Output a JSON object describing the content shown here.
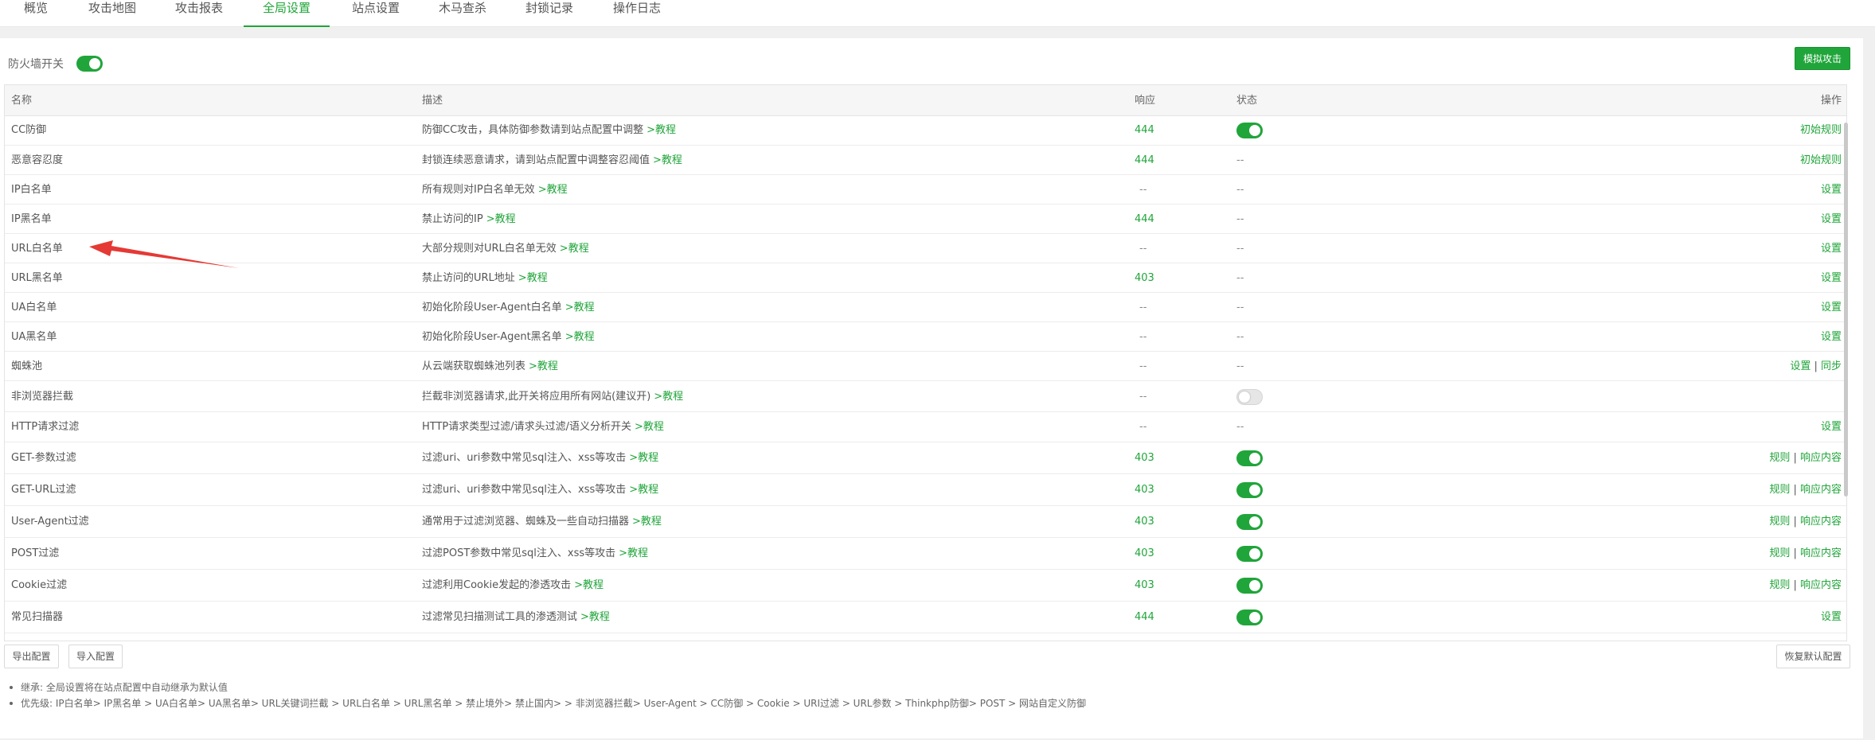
{
  "tabs": [
    {
      "label": "概览",
      "active": false
    },
    {
      "label": "攻击地图",
      "active": false
    },
    {
      "label": "攻击报表",
      "active": false
    },
    {
      "label": "全局设置",
      "active": true
    },
    {
      "label": "站点设置",
      "active": false
    },
    {
      "label": "木马查杀",
      "active": false
    },
    {
      "label": "封锁记录",
      "active": false
    },
    {
      "label": "操作日志",
      "active": false
    }
  ],
  "firewall": {
    "label": "防火墙开关",
    "enabled": true
  },
  "simulate_button": "模拟攻击",
  "table": {
    "headers": {
      "name": "名称",
      "desc": "描述",
      "response": "响应",
      "status": "状态",
      "action": "操作"
    },
    "link_text": ">教程",
    "rows": [
      {
        "name": "CC防御",
        "desc": "防御CC攻击，具体防御参数请到站点配置中调整",
        "response": "444",
        "status": "on",
        "actions": [
          "初始规则"
        ]
      },
      {
        "name": "恶意容忍度",
        "desc": "封锁连续恶意请求，请到站点配置中调整容忍阈值",
        "response": "444",
        "status": "--",
        "actions": [
          "初始规则"
        ]
      },
      {
        "name": "IP白名单",
        "desc": "所有规则对IP白名单无效",
        "response": "--",
        "status": "--",
        "actions": [
          "设置"
        ]
      },
      {
        "name": "IP黑名单",
        "desc": "禁止访问的IP",
        "response": "444",
        "status": "--",
        "actions": [
          "设置"
        ]
      },
      {
        "name": "URL白名单",
        "desc": "大部分规则对URL白名单无效",
        "response": "--",
        "status": "--",
        "actions": [
          "设置"
        ]
      },
      {
        "name": "URL黑名单",
        "desc": "禁止访问的URL地址",
        "response": "403",
        "status": "--",
        "actions": [
          "设置"
        ]
      },
      {
        "name": "UA白名单",
        "desc": "初始化阶段User-Agent白名单",
        "response": "--",
        "status": "--",
        "actions": [
          "设置"
        ]
      },
      {
        "name": "UA黑名单",
        "desc": "初始化阶段User-Agent黑名单",
        "response": "--",
        "status": "--",
        "actions": [
          "设置"
        ]
      },
      {
        "name": "蜘蛛池",
        "desc": "从云端获取蜘蛛池列表",
        "response": "--",
        "status": "--",
        "actions": [
          "设置",
          "同步"
        ]
      },
      {
        "name": "非浏览器拦截",
        "desc": "拦截非浏览器请求,此开关将应用所有网站(建议开)",
        "response": "--",
        "status": "off",
        "actions": []
      },
      {
        "name": "HTTP请求过滤",
        "desc": "HTTP请求类型过滤/请求头过滤/语义分析开关",
        "response": "--",
        "status": "--",
        "actions": [
          "设置"
        ]
      },
      {
        "name": "GET-参数过滤",
        "desc": "过滤uri、uri参数中常见sql注入、xss等攻击",
        "response": "403",
        "status": "on",
        "actions": [
          "规则",
          "响应内容"
        ]
      },
      {
        "name": "GET-URL过滤",
        "desc": "过滤uri、uri参数中常见sql注入、xss等攻击",
        "response": "403",
        "status": "on",
        "actions": [
          "规则",
          "响应内容"
        ]
      },
      {
        "name": "User-Agent过滤",
        "desc": "通常用于过滤浏览器、蜘蛛及一些自动扫描器",
        "response": "403",
        "status": "on",
        "actions": [
          "规则",
          "响应内容"
        ]
      },
      {
        "name": "POST过滤",
        "desc": "过滤POST参数中常见sql注入、xss等攻击",
        "response": "403",
        "status": "on",
        "actions": [
          "规则",
          "响应内容"
        ]
      },
      {
        "name": "Cookie过滤",
        "desc": "过滤利用Cookie发起的渗透攻击",
        "response": "403",
        "status": "on",
        "actions": [
          "规则",
          "响应内容"
        ]
      },
      {
        "name": "常见扫描器",
        "desc": "过滤常见扫描测试工具的渗透测试",
        "response": "444",
        "status": "on",
        "actions": [
          "设置"
        ]
      }
    ]
  },
  "buttons": {
    "export": "导出配置",
    "import": "导入配置",
    "restore": "恢复默认配置"
  },
  "notes": [
    "继承: 全局设置将在站点配置中自动继承为默认值",
    "优先级: IP白名单> IP黑名单 > UA白名单> UA黑名单> URL关键词拦截 > URL白名单 > URL黑名单 > 禁止境外> 禁止国内> > 非浏览器拦截> User-Agent > CC防御 > Cookie > URI过滤 > URL参数 > Thinkphp防御> POST > 网站自定义防御"
  ],
  "colors": {
    "accent": "#20a53a",
    "arrow": "#e53935"
  }
}
